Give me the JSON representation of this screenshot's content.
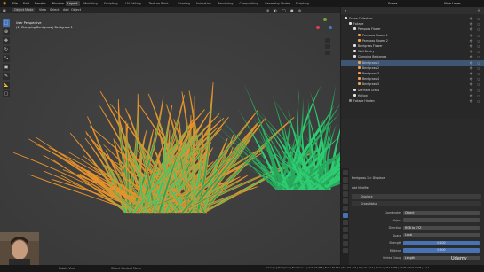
{
  "menu": [
    "File",
    "Edit",
    "Render",
    "Window",
    "Help"
  ],
  "workspace_tabs": [
    {
      "label": "Layout",
      "active": true
    },
    {
      "label": "Modeling",
      "active": false
    },
    {
      "label": "Sculpting",
      "active": false
    },
    {
      "label": "UV Editing",
      "active": false
    },
    {
      "label": "Texture Paint",
      "active": false
    },
    {
      "label": "Shading",
      "active": false
    },
    {
      "label": "Animation",
      "active": false
    },
    {
      "label": "Rendering",
      "active": false
    },
    {
      "label": "Compositing",
      "active": false
    },
    {
      "label": "Geometry Nodes",
      "active": false
    },
    {
      "label": "Scripting",
      "active": false
    }
  ],
  "scene": {
    "label": "Scene",
    "layer": "View Layer"
  },
  "header": {
    "mode": "Object Mode",
    "view": "View",
    "select": "Select",
    "add": "Add",
    "object": "Object",
    "options": "Options"
  },
  "viewport_info": {
    "line1": "User Perspective",
    "line2": "(1) Clumping Bentgrass | Bentgrass 1"
  },
  "outliner": {
    "title": "Scene Collection",
    "rows": [
      {
        "label": "Scene Collection",
        "indent": 0,
        "color": "#e0e0e0",
        "selected": false
      },
      {
        "label": "Foliage",
        "indent": 1,
        "color": "#e0e0e0",
        "selected": false
      },
      {
        "label": "Pampass Flower",
        "indent": 2,
        "color": "#e0e0e0",
        "selected": false
      },
      {
        "label": "Pampass Flower 1",
        "indent": 3,
        "color": "#f0a050",
        "selected": false
      },
      {
        "label": "Pampass Flower 2",
        "indent": 3,
        "color": "#f0a050",
        "selected": false
      },
      {
        "label": "Bentgrass Flower",
        "indent": 2,
        "color": "#e0e0e0",
        "selected": false
      },
      {
        "label": "Wall Bentry",
        "indent": 2,
        "color": "#e0e0e0",
        "selected": false
      },
      {
        "label": "Clumping Bentgrass",
        "indent": 2,
        "color": "#e0e0e0",
        "selected": false
      },
      {
        "label": "Bentgrass 1",
        "indent": 3,
        "color": "#f0a050",
        "selected": true
      },
      {
        "label": "Bentgrass 2",
        "indent": 3,
        "color": "#f0a050",
        "selected": false
      },
      {
        "label": "Bentgrass 3",
        "indent": 3,
        "color": "#f0a050",
        "selected": false
      },
      {
        "label": "Bentgrass 4",
        "indent": 3,
        "color": "#f0a050",
        "selected": false
      },
      {
        "label": "Bentgrass 5",
        "indent": 3,
        "color": "#f0a050",
        "selected": false
      },
      {
        "label": "Dormant Grass",
        "indent": 2,
        "color": "#e0e0e0",
        "selected": false
      },
      {
        "label": "Hollow",
        "indent": 2,
        "color": "#e0e0e0",
        "selected": false
      },
      {
        "label": "Foliage Hidden",
        "indent": 1,
        "color": "#888888",
        "selected": false
      }
    ]
  },
  "properties": {
    "breadcrumb": "Bentgrass 1  >  Displace",
    "add_modifier": "Add Modifier",
    "modifier_name": "Displace",
    "second_modifier": "Grass Noise",
    "fields": [
      {
        "key": "Coordinates",
        "value": "Object",
        "blue": false
      },
      {
        "key": "Object",
        "value": "",
        "blue": false
      },
      {
        "key": "Direction",
        "value": "RGB to XYZ",
        "blue": false
      },
      {
        "key": "Space",
        "value": "Local",
        "blue": false
      },
      {
        "key": "Strength",
        "value": "0.100",
        "blue": true
      },
      {
        "key": "Midlevel",
        "value": "0.500",
        "blue": true
      },
      {
        "key": "Vertex Group",
        "value": "Length",
        "blue": false
      }
    ]
  },
  "status": {
    "left": "Rotate View",
    "middle": "Object Context Menu",
    "right": "Clumping Bentgrass | Bentgrass 1 | Verts 54,888 | Faces 50,872 | Tris 101,744 | Objects 1/12 | Memory 712.6 MiB | VRAM 2.7/24.0 GiB | 3.2.1"
  },
  "watermark": "Udemy",
  "colors": {
    "accent": "#4772b3",
    "grass_green": "#2ecc71",
    "grass_orange": "#e8922b",
    "selection": "#3f5574"
  }
}
